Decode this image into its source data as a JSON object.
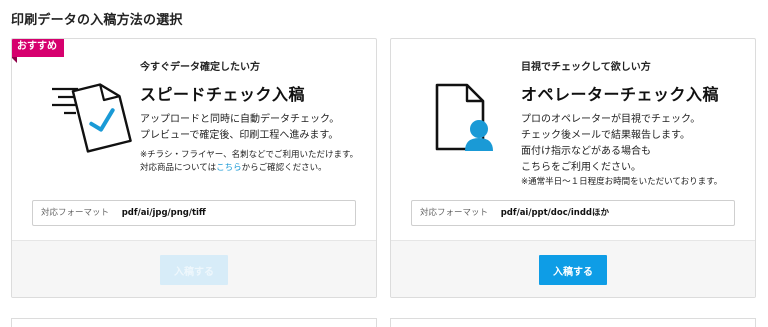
{
  "page": {
    "title": "印刷データの入稿方法の選択"
  },
  "cards": [
    {
      "badge": "おすすめ",
      "subtitle": "今すぐデータ確定したい方",
      "heading": "スピードチェック入稿",
      "desc": [
        "アップロードと同時に自動データチェック。",
        "プレビューで確定後、印刷工程へ進みます。"
      ],
      "note_line1": "※チラシ・フライヤー、名刺などでご利用いただけます。",
      "note_line2_pre": "対応商品については",
      "note_link": "こちら",
      "note_line2_post": "からご確認ください。",
      "format_label": "対応フォーマット",
      "format_value": "pdf/ai/jpg/png/tiff",
      "button": "入稿する",
      "button_state": "disabled",
      "icon": "document-check-icon"
    },
    {
      "subtitle": "目視でチェックして欲しい方",
      "heading": "オペレーターチェック入稿",
      "desc": [
        "プロのオペレーターが目視でチェック。",
        "チェック後メールで結果報告します。",
        "面付け指示などがある場合も",
        "こちらをご利用ください。"
      ],
      "note": "※通常半日〜１日程度お時間をいただいております。",
      "format_label": "対応フォーマット",
      "format_value": "pdf/ai/ppt/doc/inddほか",
      "button": "入稿する",
      "button_state": "active",
      "icon": "document-operator-icon"
    }
  ],
  "colors": {
    "accent": "#0e9de6",
    "badge": "#d6006e",
    "link": "#1a9ad6"
  }
}
